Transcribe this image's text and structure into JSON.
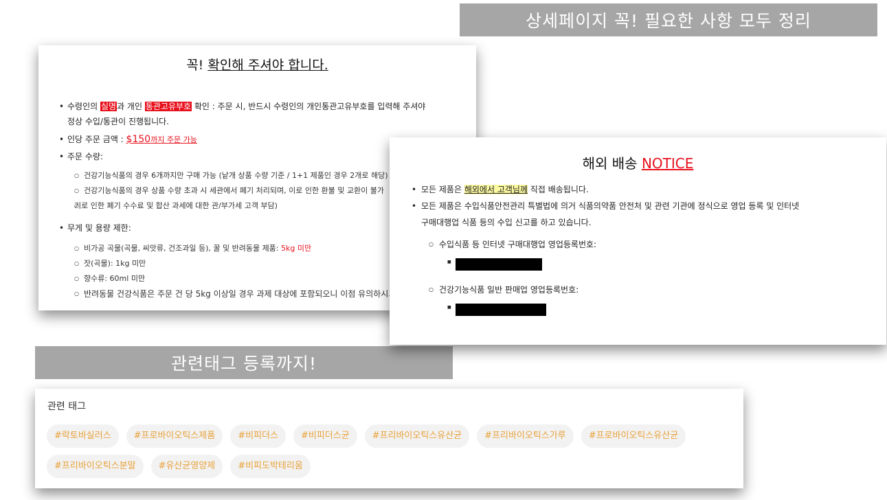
{
  "banners": {
    "top": "상세페이지 꼭! 필요한 사항 모두 정리",
    "tags": "관련태그 등록까지!"
  },
  "confirm_card": {
    "title_prefix": "꼭! ",
    "title_main": "확인해 주셔야 합니다.",
    "item1": {
      "t1": "수령인의 ",
      "h1": "실명",
      "t2": "과 개인 ",
      "h2": "통관고유부호",
      "t3": " 확인 : 주문 시, 반드시 수령인의 개인통관고유부호를 입력해 주셔야",
      "t4": "정상 수입/통관이 진행됩니다."
    },
    "item2": {
      "t1": "인당 주문 금액 : ",
      "price": "$150",
      "note": "까지 주문 가능"
    },
    "item3": {
      "label": "주문 수량:",
      "sub1": "건강기능식품의 경우 6개까지만 구매 가능 (낱개 상품 수량 기준 / 1+1 제품인 경우 2개로 해당)",
      "sub2a": "건강기능식품의 경우 상품 수량 초과 시 세관에서 폐기 처리되며, 이로 인한 환불 및 교환이 불가",
      "sub2b": "기로 인한 폐기 수수료 및 합산 과세에 대한 관/부가세 고객 부담)"
    },
    "item4": {
      "label": "무게 및 용량 제한:",
      "sub1a": "비가공 곡물(곡물, 씨앗류, 건조과일 등), 꿀 및 반려동물 제품: ",
      "sub1b": "5kg 미만",
      "sub2": "잣(곡물): 1kg 미만",
      "sub3": "향수류: 60ml 미만",
      "sub4": "반려동물 건강식품은 주문 건 당 5kg 이상일 경우 과제 대상에 포함되오니 이점 유의하시기 바랍니다."
    }
  },
  "notice_card": {
    "title_prefix": "해외 배송 ",
    "title_accent": "NOTICE",
    "item1a": "모든 제품은 ",
    "item1b": "해외에서 고객님께",
    "item1c": " 직접 배송됩니다.",
    "item2a": "모든 제품은 수입식품안전관리 특별법에 의거 식품의약품 안전처 및 관련 기관에 정식으로 영업 등록 및 인터넷",
    "item2b": "구매대행업 식품 등의 수입 신고를 하고 있습니다.",
    "sub1": "수입식품 등 인터넷 구매대행업 영업등록번호:",
    "sub2": "건강기능식품 일반 판매업 영업등록번호:"
  },
  "tags_card": {
    "heading": "관련 태그",
    "tags": [
      "#락토바실러스",
      "#프로바이오틱스제품",
      "#비피더스",
      "#비피더스균",
      "#프리바이오틱스유산균",
      "#프리바이오틱스가루",
      "#프로바이오틱스유산균",
      "#프리바이오틱스분말",
      "#유산균영양제",
      "#비피도박테리움"
    ]
  },
  "colors": {
    "banner": "#a6a6a6",
    "accent_red": "#e8101c",
    "tag_text": "#e8a23a",
    "highlight_yellow": "#fbf8a0"
  }
}
